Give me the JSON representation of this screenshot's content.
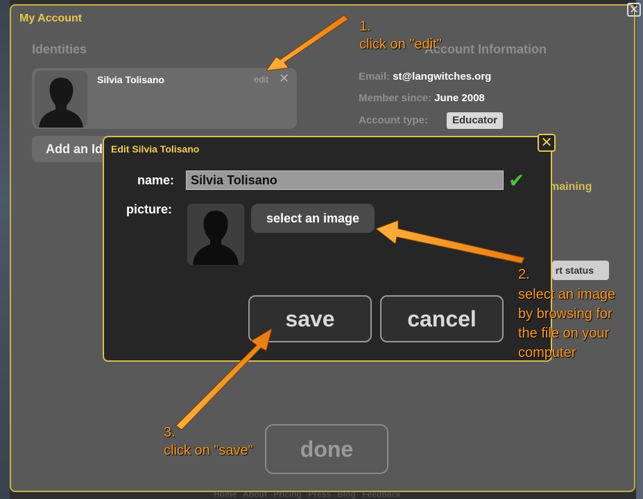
{
  "window": {
    "title": "My Account",
    "close_label": "✕"
  },
  "footer": {
    "links": "Home About Pricing Press Blog Feedback"
  },
  "identities": {
    "section_title": "Identities",
    "card": {
      "name": "Silvia Tolisano",
      "edit_label": "edit",
      "remove_icon": "✕",
      "avatar_icon": "person-silhouette-icon"
    },
    "add_label": "Add an Identity"
  },
  "account_information": {
    "section_title": "Account Information",
    "email_label": "Email:",
    "email_value": "st@langwitches.org",
    "member_since_label": "Member since:",
    "member_since_value": "June 2008",
    "account_type_label": "Account type:",
    "account_type_value": "Educator",
    "remaining_text": "maining",
    "status_button_label": "rt status"
  },
  "done_label": "done",
  "dialog": {
    "title": "Edit Silvia Tolisano",
    "close_label": "✕",
    "name_label": "name:",
    "name_value": "Silvia Tolisano",
    "check_icon": "✔",
    "picture_label": "picture:",
    "select_image_label": "select an image",
    "save_label": "save",
    "cancel_label": "cancel"
  },
  "annotations": {
    "step1_number": "1.",
    "step1_text": "click on \"edit\"",
    "step2_number": "2.",
    "step2_lines": [
      "select an image",
      "by browsing for",
      "the file on your",
      "computer"
    ],
    "step3_number": "3.",
    "step3_text": "click on \"save\""
  },
  "colors": {
    "accent": "#e8c84a",
    "annotation": "#ff9a1f",
    "check": "#4fc23a",
    "panel": "#595959",
    "dialog": "#262626"
  }
}
